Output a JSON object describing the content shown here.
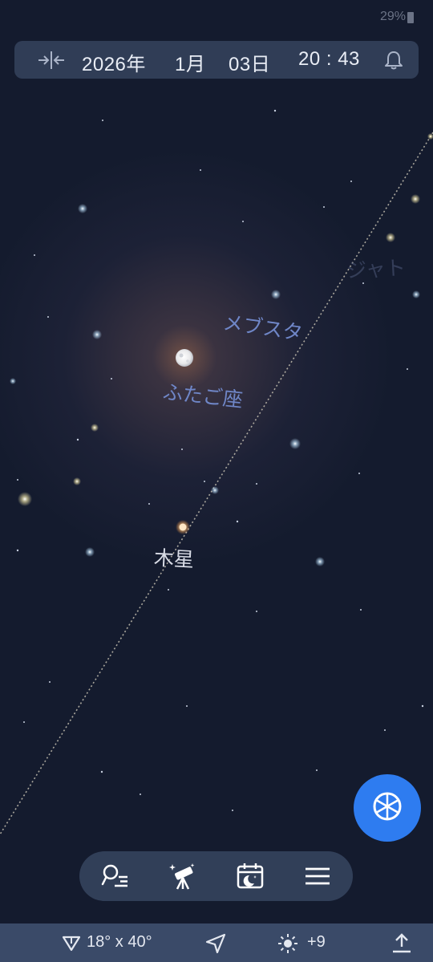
{
  "status_bar": {
    "battery": "29%"
  },
  "date_bar": {
    "year": "2026年",
    "month": "1月",
    "day": "03日",
    "time": "20 : 43"
  },
  "sky_labels": {
    "constellation_gemini": "ふたご座",
    "star_mebsuta": "メブスタ",
    "planet_jupiter": "木星",
    "faded_label": "ジャト"
  },
  "bottom_bar": {
    "field_of_view": "18° x 40°",
    "brightness": "+9"
  },
  "icons": {
    "collapse": "collapse-arrows-icon",
    "bell": "bell-icon",
    "fab": "wheel-icon",
    "search": "search-list-icon",
    "telescope": "telescope-icon",
    "calendar": "calendar-night-icon",
    "menu": "hamburger-menu-icon",
    "fov": "fov-triangle-icon",
    "navigate": "navigation-arrow-icon",
    "sun": "sun-brightness-icon",
    "share": "upload-share-icon"
  },
  "colors": {
    "sky": "#141b2e",
    "accent": "#2e7cf0",
    "constellation_label": "#6f86c7",
    "bar": "#34425c"
  }
}
